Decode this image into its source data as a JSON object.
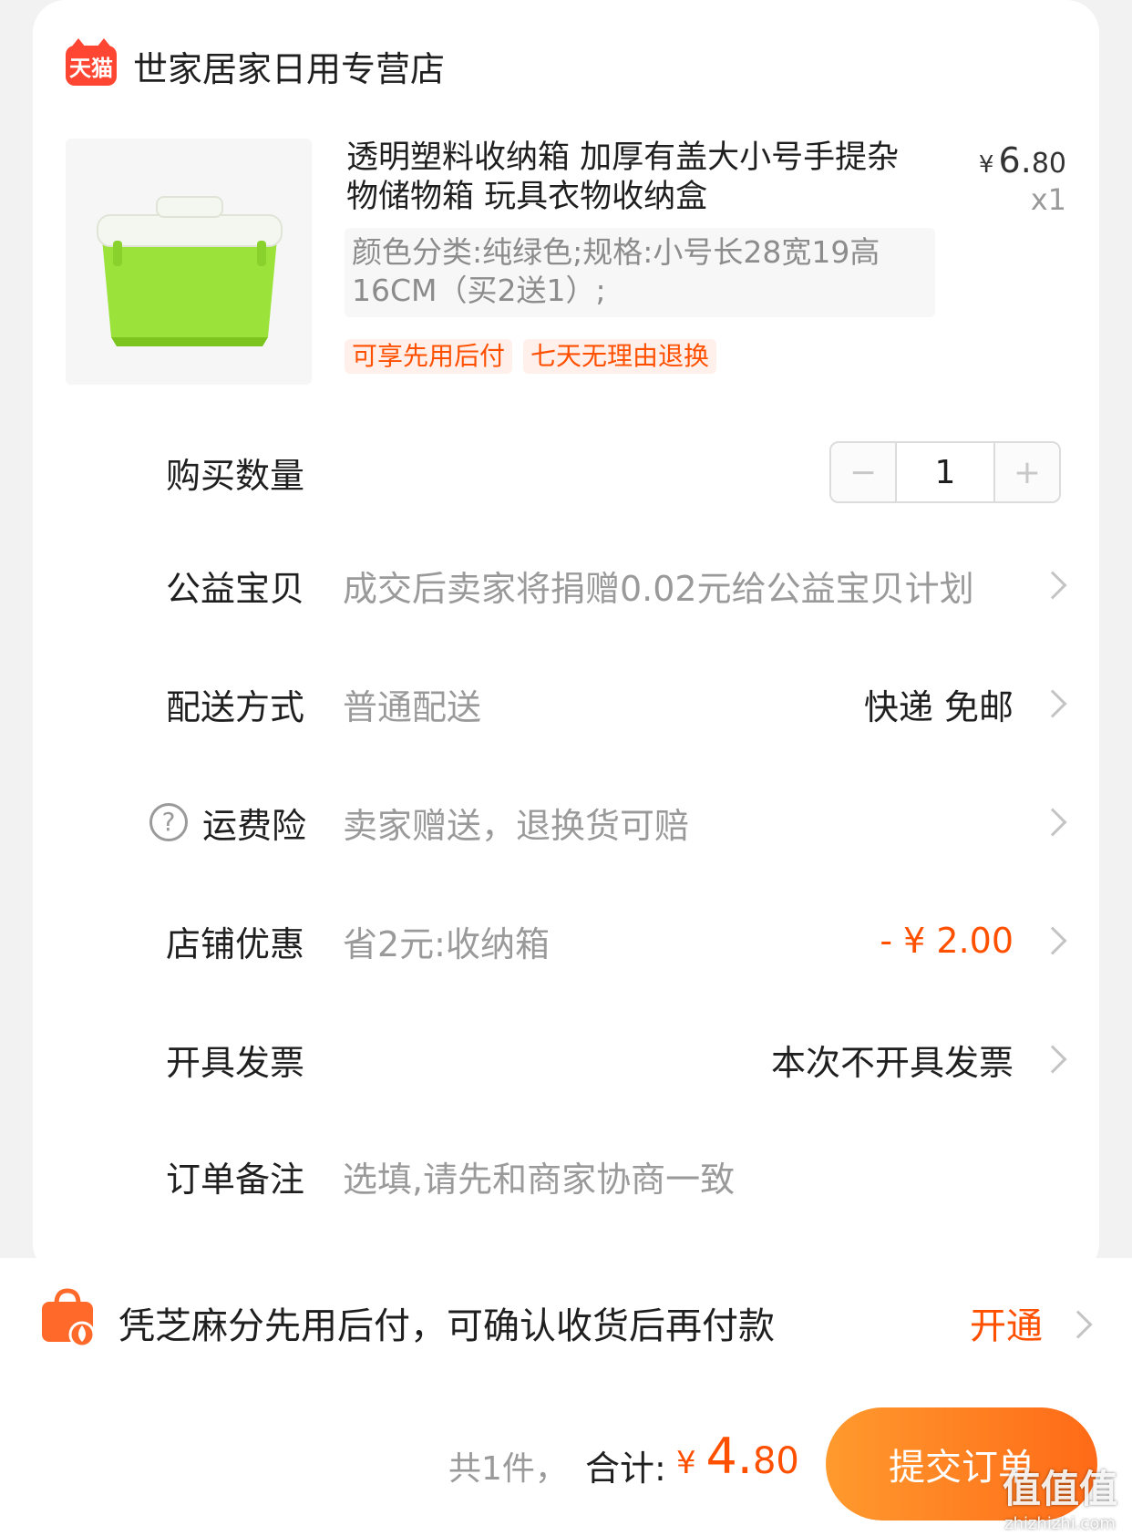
{
  "store": {
    "badge": "天猫",
    "name": "世家居家日用专营店"
  },
  "product": {
    "image_icon": "green-storage-box-image",
    "title": "透明塑料收纳箱 加厚有盖大小号手提杂物储物箱 玩具衣物收纳盒",
    "price_symbol": "¥",
    "price_int": "6.",
    "price_dec": "80",
    "qty": "x1",
    "sku": "颜色分类:纯绿色;规格:小号长28宽19高16CM（买2送1）;",
    "tags": [
      "可享先用后付",
      "七天无理由退换"
    ]
  },
  "rows": {
    "quantity": {
      "label": "购买数量",
      "value": "1",
      "minus": "−",
      "plus": "+"
    },
    "charity": {
      "label": "公益宝贝",
      "value": "成交后卖家将捐赠0.02元给公益宝贝计划"
    },
    "delivery": {
      "label": "配送方式",
      "value": "普通配送",
      "right": "快递 免邮"
    },
    "insurance": {
      "label": "运费险",
      "value": "卖家赠送，退换货可赔",
      "help_icon": "?"
    },
    "coupon": {
      "label": "店铺优惠",
      "value": "省2元:收纳箱",
      "right": "- ¥ 2.00"
    },
    "invoice": {
      "label": "开具发票",
      "right": "本次不开具发票"
    },
    "remark": {
      "label": "订单备注",
      "placeholder": "选填,请先和商家协商一致"
    }
  },
  "paylater": {
    "text": "凭芝麻分先用后付，可确认收货后再付款",
    "action": "开通"
  },
  "footer": {
    "count": "共1件，",
    "total_label": "合计:",
    "price_symbol": "¥ ",
    "price_int": "4.",
    "price_dec": "80",
    "submit": "提交订单"
  },
  "watermark": {
    "main": "值值值",
    "sub": "zhizhizhi.com"
  },
  "colors": {
    "accent": "#ff5000",
    "tmall_red": "#ff4633",
    "button_gradient_start": "#ff9a2e",
    "button_gradient_end": "#ff6a17"
  }
}
